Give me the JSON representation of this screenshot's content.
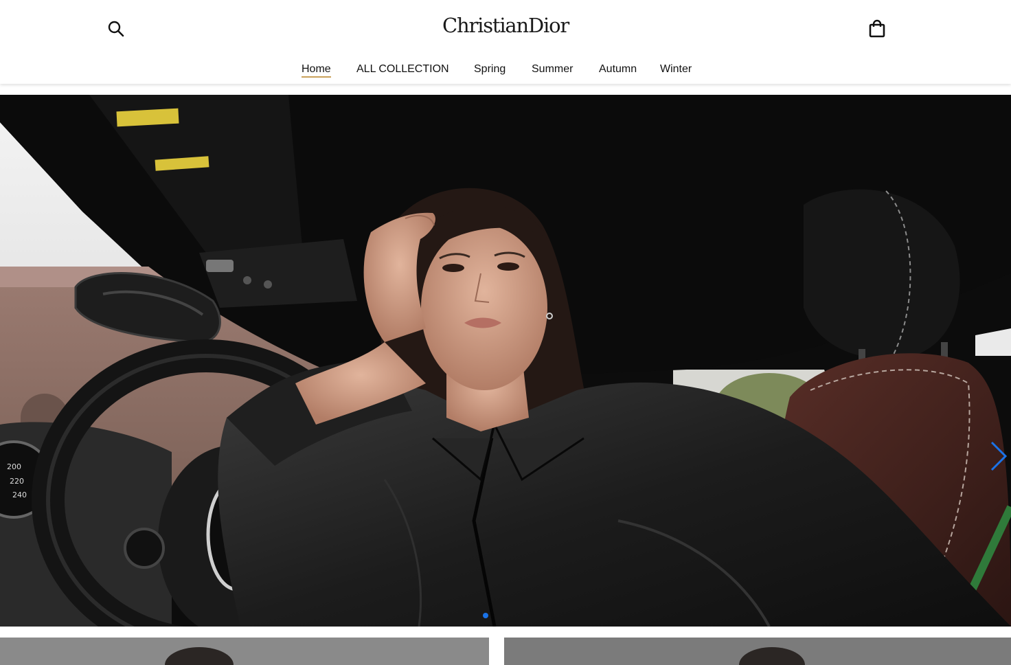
{
  "header": {
    "logo_text": "ChristianDior",
    "search_icon": "search-icon",
    "bag_icon": "shopping-bag-icon"
  },
  "nav": {
    "items": [
      {
        "label": "Home",
        "active": true
      },
      {
        "label": "ALL COLLECTION",
        "active": false
      },
      {
        "label": "Spring",
        "active": false
      },
      {
        "label": "Summer",
        "active": false
      },
      {
        "label": "Autumn",
        "active": false
      },
      {
        "label": "Winter",
        "active": false
      }
    ]
  },
  "carousel": {
    "next_icon": "chevron-right-icon",
    "slide_count_visible": 1,
    "active_slide_index": 0
  },
  "colors": {
    "nav_active_underline": "#c9a15a",
    "carousel_accent": "#1a73e8"
  }
}
